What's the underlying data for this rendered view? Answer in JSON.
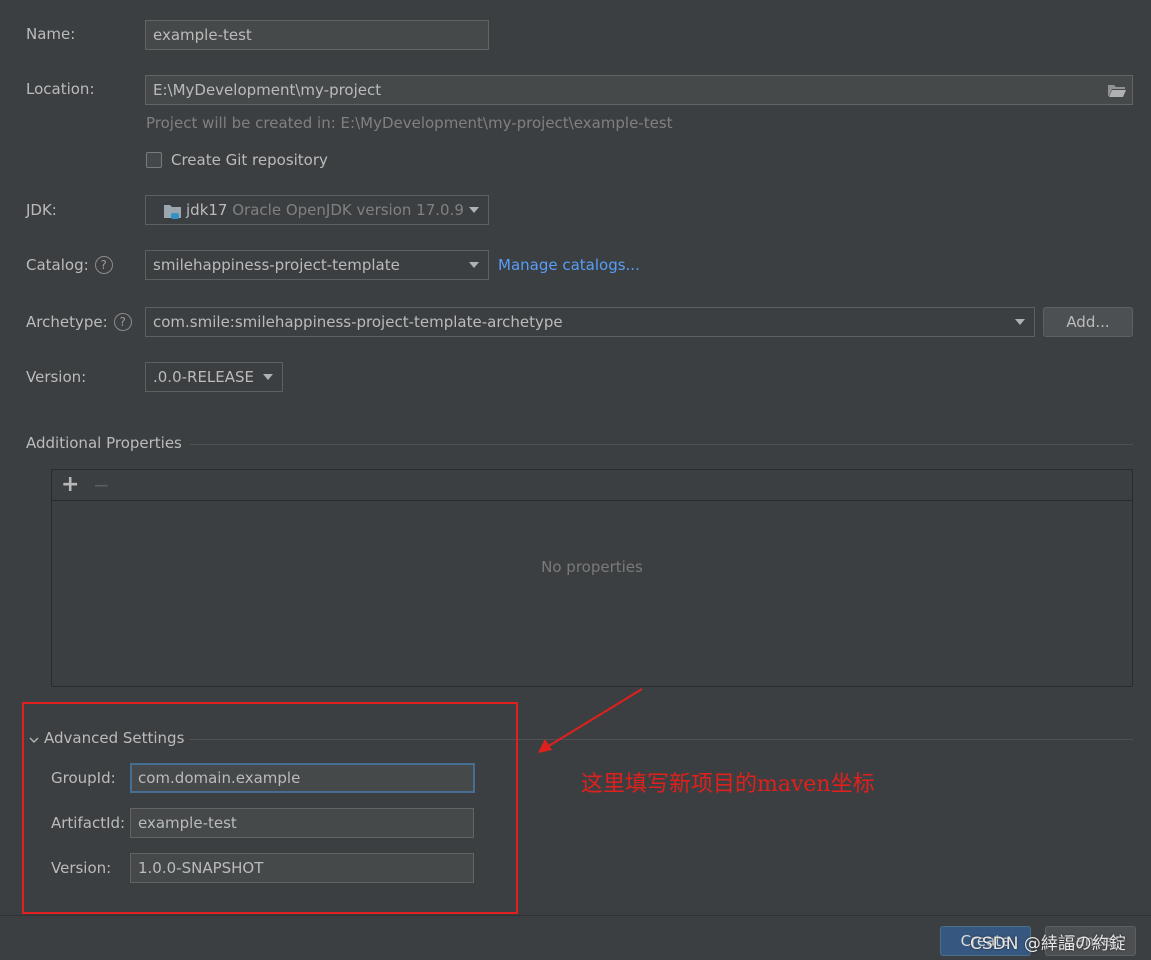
{
  "form": {
    "name_label": "Name:",
    "name_value": "example-test",
    "location_label": "Location:",
    "location_value": "E:\\MyDevelopment\\my-project",
    "location_hint": "Project will be created in: E:\\MyDevelopment\\my-project\\example-test",
    "git_label": "Create Git repository",
    "git_checked": false,
    "jdk_label": "JDK:",
    "jdk_name": "jdk17",
    "jdk_detail": "Oracle OpenJDK version 17.0.9",
    "catalog_label": "Catalog:",
    "catalog_value": "smilehappiness-project-template",
    "manage_catalogs": "Manage catalogs...",
    "archetype_label": "Archetype:",
    "archetype_value": "com.smile:smilehappiness-project-template-archetype",
    "add_button": "Add...",
    "version_label": "Version:",
    "version_value": ".0.0-RELEASE",
    "help_glyph": "?"
  },
  "properties": {
    "title": "Additional Properties",
    "add": "+",
    "remove": "−",
    "empty": "No properties"
  },
  "advanced": {
    "title": "Advanced Settings",
    "groupid_label": "GroupId:",
    "groupid_value": "com.domain.example",
    "artifactid_label": "ArtifactId:",
    "artifactid_value": "example-test",
    "version_label": "Version:",
    "version_value": "1.0.0-SNAPSHOT"
  },
  "annotation": {
    "text": "这里填写新项目的maven坐标",
    "color": "#e0201c"
  },
  "footer": {
    "create_button": "Create",
    "cancel_button": "Cancel",
    "watermark": "CSDN @緈諨の約錠"
  }
}
